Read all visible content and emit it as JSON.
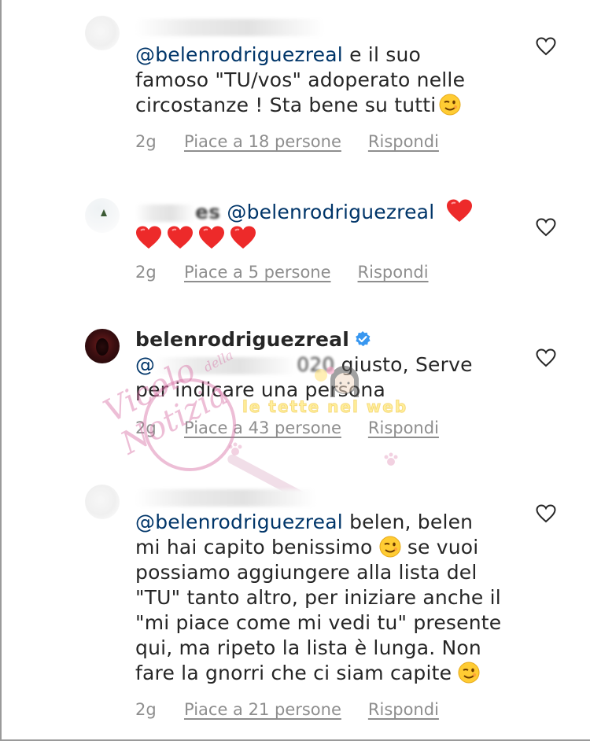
{
  "comments": [
    {
      "id": "c1",
      "username_visible": "",
      "body_mention": "@belenrodriguezreal",
      "body_line1_rest": " e il suo",
      "body_line2": "famoso \"TU/vos\" adoperato nelle",
      "body_line3": "circostanze ! Sta bene su tutti",
      "time": "2g",
      "likes": "Piace a 18 persone",
      "reply": "Rispondi"
    },
    {
      "id": "c2",
      "username_visible": "es",
      "body_mention": "@belenrodriguezreal",
      "time": "2g",
      "likes": "Piace a 5 persone",
      "reply": "Rispondi"
    },
    {
      "id": "c3",
      "username": "belenrodriguezreal",
      "body_mention_start": "@",
      "body_mention_end": "020",
      "body_line1_rest": " giusto, Serve",
      "body_line2": "per indicare una persona",
      "time": "2g",
      "likes": "Piace a 43 persone",
      "reply": "Rispondi"
    },
    {
      "id": "c4",
      "body_mention": "@belenrodriguezreal",
      "body_line1_rest": " belen, belen",
      "body_line2a": "mi hai capito benissimo ",
      "body_line2b": " se vuoi",
      "body_line3": "possiamo aggiungere alla lista del",
      "body_line4": "\"TU\" tanto altro, per iniziare anche il",
      "body_line5": "\"mi piace come mi vedi tu\" presente",
      "body_line6": "qui, ma ripeto la lista è lunga. Non",
      "body_line7": "fare la gnorri che ci siam capite ",
      "time": "2g",
      "likes": "Piace a 21 persone",
      "reply": "Rispondi"
    }
  ],
  "watermark": {
    "script_text": "Vicolo",
    "small_text": "della",
    "script_text_2": "Notizia",
    "yellow_text": "le tette nel web"
  },
  "icons": {
    "like": "heart-outline-icon",
    "wink": "winking-face-emoji",
    "love": "red-heart-emoji",
    "verified": "verified-badge-icon"
  },
  "colors": {
    "mention": "#003569",
    "meta": "#8e8e8e",
    "text": "#262626",
    "verified": "#3897f0",
    "heart": "#ed2a2a"
  }
}
